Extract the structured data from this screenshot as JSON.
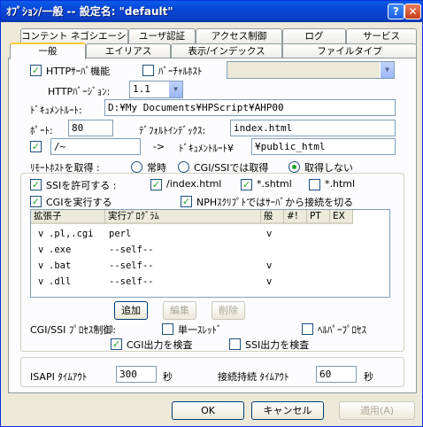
{
  "window": {
    "title": "ｵﾌﾟｼｮﾝ/一般 -- 設定名: \"default\"",
    "help_glyph": "?",
    "close_glyph": "✕"
  },
  "tabs_row1": [
    "コンテント ネゴシエーション",
    "ユーザ認証",
    "アクセス制御",
    "ログ",
    "サービス"
  ],
  "tabs_row2": [
    "一般",
    "エイリアス",
    "表示/インデックス",
    "ファイルタイプ"
  ],
  "form": {
    "http_server": {
      "label": "HTTPｻｰﾊﾞ機能",
      "checked": true
    },
    "virtual_host": {
      "label": "ﾊﾞｰﾁｬﾙﾎｽﾄ",
      "checked": false,
      "value": ""
    },
    "http_version": {
      "label": "HTTPﾊﾞｰｼﾞｮﾝ:",
      "value": "1.1"
    },
    "doc_root": {
      "label": "ﾄﾞｷｭﾒﾝﾄﾙｰﾄ:",
      "value": "D:¥My Documents¥HPScript¥AHP00"
    },
    "port": {
      "label": "ﾎﾟｰﾄ:",
      "value": "80"
    },
    "default_index": {
      "label": "ﾃﾞﾌｫﾙﾄｲﾝﾃﾞｯｸｽ:",
      "value": "index.html"
    },
    "user_dir": {
      "checked": true,
      "value": "/~",
      "arrow": "->",
      "root_label": "ﾄﾞｷｭﾒﾝﾄﾙｰﾄ¥",
      "root_value": "¥public_html"
    },
    "remote_host": {
      "label": "ﾘﾓｰﾄﾎｽﾄを取得 :",
      "options": [
        "常時",
        "CGI/SSIでは取得",
        "取得しない"
      ],
      "selected": 2
    }
  },
  "ssi": {
    "allow": {
      "label": "SSIを許可する :",
      "checked": true
    },
    "ext": [
      {
        "label": "/index.html",
        "checked": true
      },
      {
        "label": "*.shtml",
        "checked": true
      },
      {
        "label": "*.html",
        "checked": false
      }
    ],
    "cgi_run": {
      "label": "CGIを実行する",
      "checked": true
    },
    "nph": {
      "label": "NPHｽｸﾘﾌﾟﾄではｻｰﾊﾞから接続を切る",
      "checked": true
    }
  },
  "cgi_table": {
    "headers": [
      "拡張子",
      "実行ﾌﾟﾛｸﾞﾗﾑ",
      "般",
      "#!",
      "PT",
      "EX"
    ],
    "rows": [
      {
        "mark": "v",
        "ext": ".pl,.cgi",
        "prog": "perl",
        "gen": "v",
        "shebang": "",
        "pt": "",
        "ex": ""
      },
      {
        "mark": "v",
        "ext": ".exe",
        "prog": "--self--",
        "gen": "",
        "shebang": "",
        "pt": "",
        "ex": ""
      },
      {
        "mark": "v",
        "ext": ".bat",
        "prog": "--self--",
        "gen": "v",
        "shebang": "",
        "pt": "",
        "ex": ""
      },
      {
        "mark": "v",
        "ext": ".dll",
        "prog": "--self--",
        "gen": "v",
        "shebang": "",
        "pt": "",
        "ex": ""
      }
    ]
  },
  "table_buttons": {
    "add": "追加",
    "edit": "編集",
    "delete": "削除"
  },
  "process_control": {
    "label": "CGI/SSI ﾌﾟﾛｾｽ制御:",
    "single_thread": {
      "label": "単一ｽﾚｯﾄﾞ",
      "checked": false
    },
    "helper": {
      "label": "ﾍﾙﾊﾟｰﾌﾟﾛｾｽ",
      "checked": false
    },
    "cgi_check": {
      "label": "CGI出力を検査",
      "checked": true
    },
    "ssi_check": {
      "label": "SSI出力を検査",
      "checked": false
    }
  },
  "timeouts": {
    "isapi_label": "ISAPI ﾀｲﾑｱｳﾄ",
    "isapi_value": "300",
    "isapi_unit": "秒",
    "keepalive_label": "接続持続 ﾀｲﾑｱｳﾄ",
    "keepalive_value": "60",
    "keepalive_unit": "秒"
  },
  "dialog_buttons": {
    "ok": "OK",
    "cancel": "キャンセル",
    "apply": "適用(A)"
  },
  "glyphs": {
    "check": "✓",
    "dropdown": "▼"
  },
  "colors": {
    "title_bar": "#0846d7",
    "face": "#ece9d8",
    "tab_highlight": "#ffc83c",
    "check_mark": "#21a121"
  }
}
